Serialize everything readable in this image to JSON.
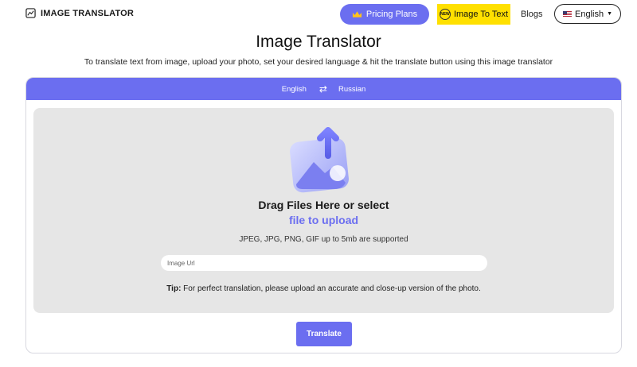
{
  "header": {
    "logo_text": "IMAGE TRANSLATOR",
    "pricing_label": "Pricing Plans",
    "new_badge": "NEW",
    "image_to_text_label": "Image To Text",
    "blogs_label": "Blogs",
    "language_label": "English"
  },
  "hero": {
    "title": "Image Translator",
    "subtitle": "To translate text from image, upload your photo, set your desired language & hit the translate button using this image translator"
  },
  "translator": {
    "source_language": "English",
    "swap_symbol": "⇄",
    "target_language": "Russian",
    "drag_text": "Drag Files Here or select",
    "upload_link": "file to upload",
    "formats_text": "JPEG, JPG, PNG, GIF up to 5mb are supported",
    "url_placeholder": "Image Url",
    "tip_label": "Tip:",
    "tip_text": " For perfect translation, please upload an accurate and close-up version of the photo.",
    "translate_button": "Translate"
  },
  "colors": {
    "accent": "#6b6ef0",
    "highlight": "#ffe000",
    "dropzone_bg": "#e6e6e6"
  }
}
